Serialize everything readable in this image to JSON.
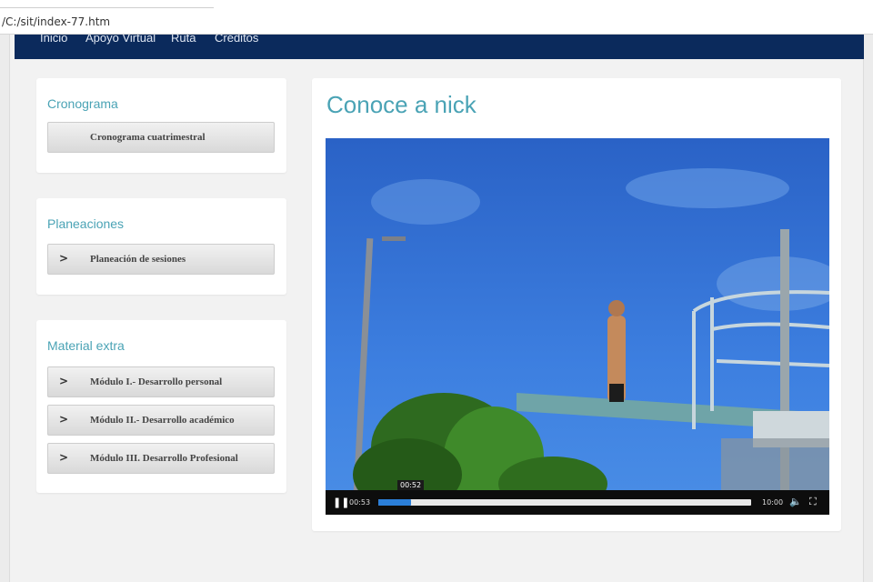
{
  "browser": {
    "url": "/C:/sit/index-77.htm"
  },
  "nav": {
    "items": [
      "Inicio",
      "Apoyo Virtual",
      "Ruta",
      "Créditos"
    ]
  },
  "sidebar": {
    "cronograma": {
      "title": "Cronograma",
      "button": "Cronograma cuatrimestral"
    },
    "planeaciones": {
      "title": "Planeaciones",
      "button": "Planeación de sesiones"
    },
    "material": {
      "title": "Material extra",
      "buttons": [
        "Módulo I.- Desarrollo personal",
        "Módulo II.- Desarrollo académico",
        "Módulo III. Desarrollo Profesional"
      ]
    }
  },
  "main": {
    "title": "Conoce a nick",
    "video": {
      "current_time": "00:53",
      "hover_time": "00:52",
      "duration": "10:00",
      "progress_fraction": 0.088,
      "play_state": "pause-icon",
      "volume_icon": "volume-icon",
      "fullscreen_icon": "fullscreen-icon"
    }
  },
  "colors": {
    "nav_bg": "#0b2a5c",
    "accent": "#4aa3b5",
    "progress": "#2b7fd9"
  }
}
